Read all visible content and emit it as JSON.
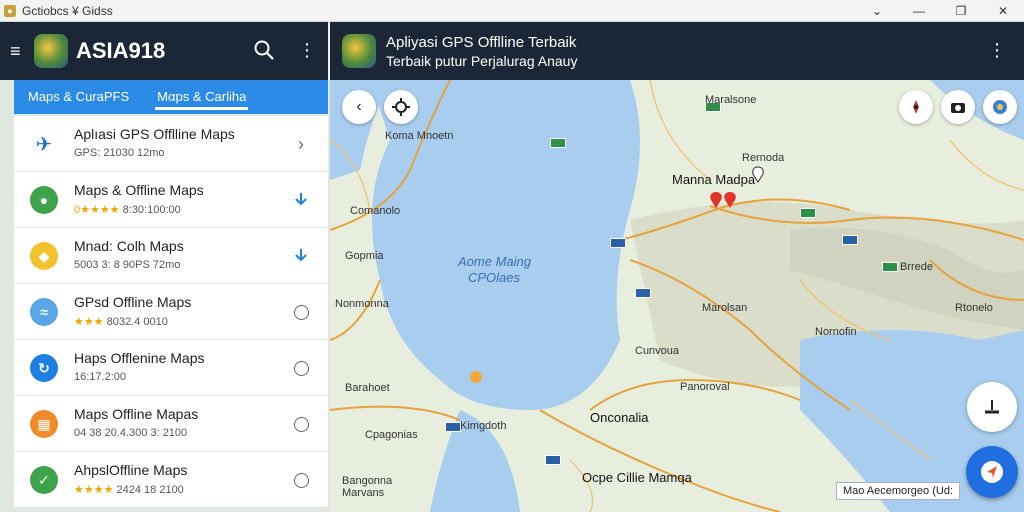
{
  "window": {
    "title": "Gctiobcs ¥ Gidss",
    "controls": [
      "chevron-down-icon",
      "minimize-icon",
      "restore-icon",
      "close-icon"
    ]
  },
  "left_header": {
    "brand": "ASIA918"
  },
  "right_header": {
    "title_line1": "Apliyasi GPS Offlline Terbaik",
    "title_line2": "Terbaik putur Perjalurag Anauy"
  },
  "tabs": [
    {
      "label": "Maps & CuraPFS",
      "active": false
    },
    {
      "label": "Mαps & Carliha",
      "active": true
    }
  ],
  "list": [
    {
      "name": "Aplıasi GPS Offlline Maps",
      "sub": "GPS: 21030 12mo",
      "stars": "",
      "icon_color": "#ffffff",
      "icon_glyph": "✈",
      "action": "chevron"
    },
    {
      "name": "Maps & Offline Maps",
      "sub": "8:30:100:00",
      "stars": "0★★★★",
      "icon_color": "#3ea24a",
      "icon_glyph": "●",
      "action": "download"
    },
    {
      "name": "Mnad: Colh Maps",
      "sub": "5003 3: 8 90PS 72mo",
      "stars": "",
      "icon_color": "#f2c12e",
      "icon_glyph": "◆",
      "action": "download"
    },
    {
      "name": "GPsd Offline Maps",
      "sub": "8032.4 0010",
      "stars": "★★★",
      "icon_color": "#5aa6e8",
      "icon_glyph": "≈",
      "action": "radio"
    },
    {
      "name": "Haps Offlenine Maps",
      "sub": "16:17.2:00",
      "stars": "",
      "icon_color": "#1e7fe0",
      "icon_glyph": "↻",
      "action": "radio"
    },
    {
      "name": "Maps Offline Mapas",
      "sub": "04 38 20.4.300 3: 2100",
      "stars": "",
      "icon_color": "#f08a2a",
      "icon_glyph": "▦",
      "action": "radio"
    },
    {
      "name": "AhpslOffline Maps",
      "sub": "2424 18 2100",
      "stars": "★★★★",
      "icon_color": "#3ea24a",
      "icon_glyph": "✓",
      "action": "radio"
    }
  ],
  "map": {
    "labels": {
      "koma": "Koma Mnoetn",
      "manna": "Manna Madpa",
      "comanolo": "Comanolo",
      "aome": "Aome Maing",
      "cpolaes": "CPOlaes",
      "gopmia": "Gopmia",
      "maralsone": "Maralsone",
      "rernoda": "Rernoda",
      "brrede": "Brrede",
      "rtonelo": "Rtonelo",
      "nornofin": "Nornofin",
      "onconalia": "Onconalia",
      "kimgdoth": "Kimgdoth",
      "cpagonias": "Cpagonias",
      "bangonna": "Bangonna",
      "marvans": "Marvans",
      "marolsan": "Marolsan",
      "cunvoua": "Cunvoua",
      "panoroval": "Panoroval",
      "nonmonna": "Nonmonna",
      "ocpe": "Ocpe Cillie Mamqa",
      "barahoet": "Barahoet"
    },
    "scale_text": "Mao Aecemorgeo (Ud:"
  }
}
